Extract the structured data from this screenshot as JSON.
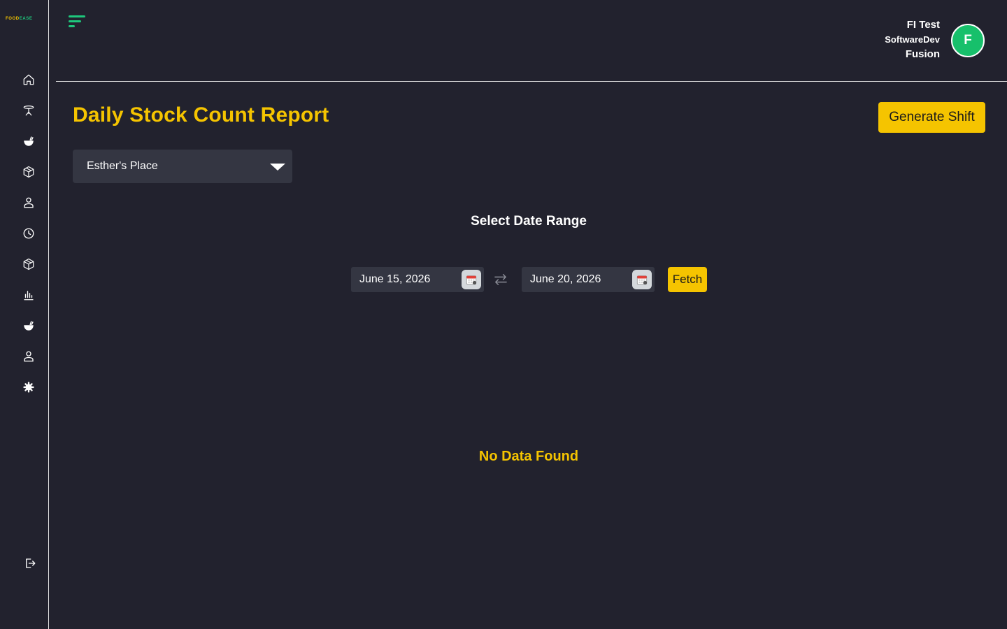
{
  "brand": {
    "logo_part1": "FOOD",
    "logo_part2": "EASE"
  },
  "sidebar": {
    "items": [
      {
        "icon": "home-icon"
      },
      {
        "icon": "dining-table-icon"
      },
      {
        "icon": "food-bowl-icon"
      },
      {
        "icon": "inventory-box-icon"
      },
      {
        "icon": "user-icon"
      },
      {
        "icon": "clock-icon"
      },
      {
        "icon": "package-icon"
      },
      {
        "icon": "bar-chart-icon"
      },
      {
        "icon": "menu-items-icon"
      },
      {
        "icon": "staff-icon"
      },
      {
        "icon": "settings-gear-icon"
      }
    ],
    "logout_icon": "logout-icon"
  },
  "user": {
    "name": "FI Test",
    "role": "SoftwareDev",
    "org": "Fusion",
    "avatar_initial": "F"
  },
  "page": {
    "title": "Daily Stock Count Report",
    "generate_button": "Generate Shift",
    "location": "Esther's Place",
    "date_range_title": "Select Date Range",
    "start_date": "June 15, 2026",
    "end_date": "June 20, 2026",
    "fetch_button": "Fetch",
    "empty_message": "No Data Found"
  },
  "colors": {
    "background": "#22222e",
    "accent_yellow": "#f5c400",
    "accent_green": "#1ec77c",
    "field_bg": "#343642"
  }
}
